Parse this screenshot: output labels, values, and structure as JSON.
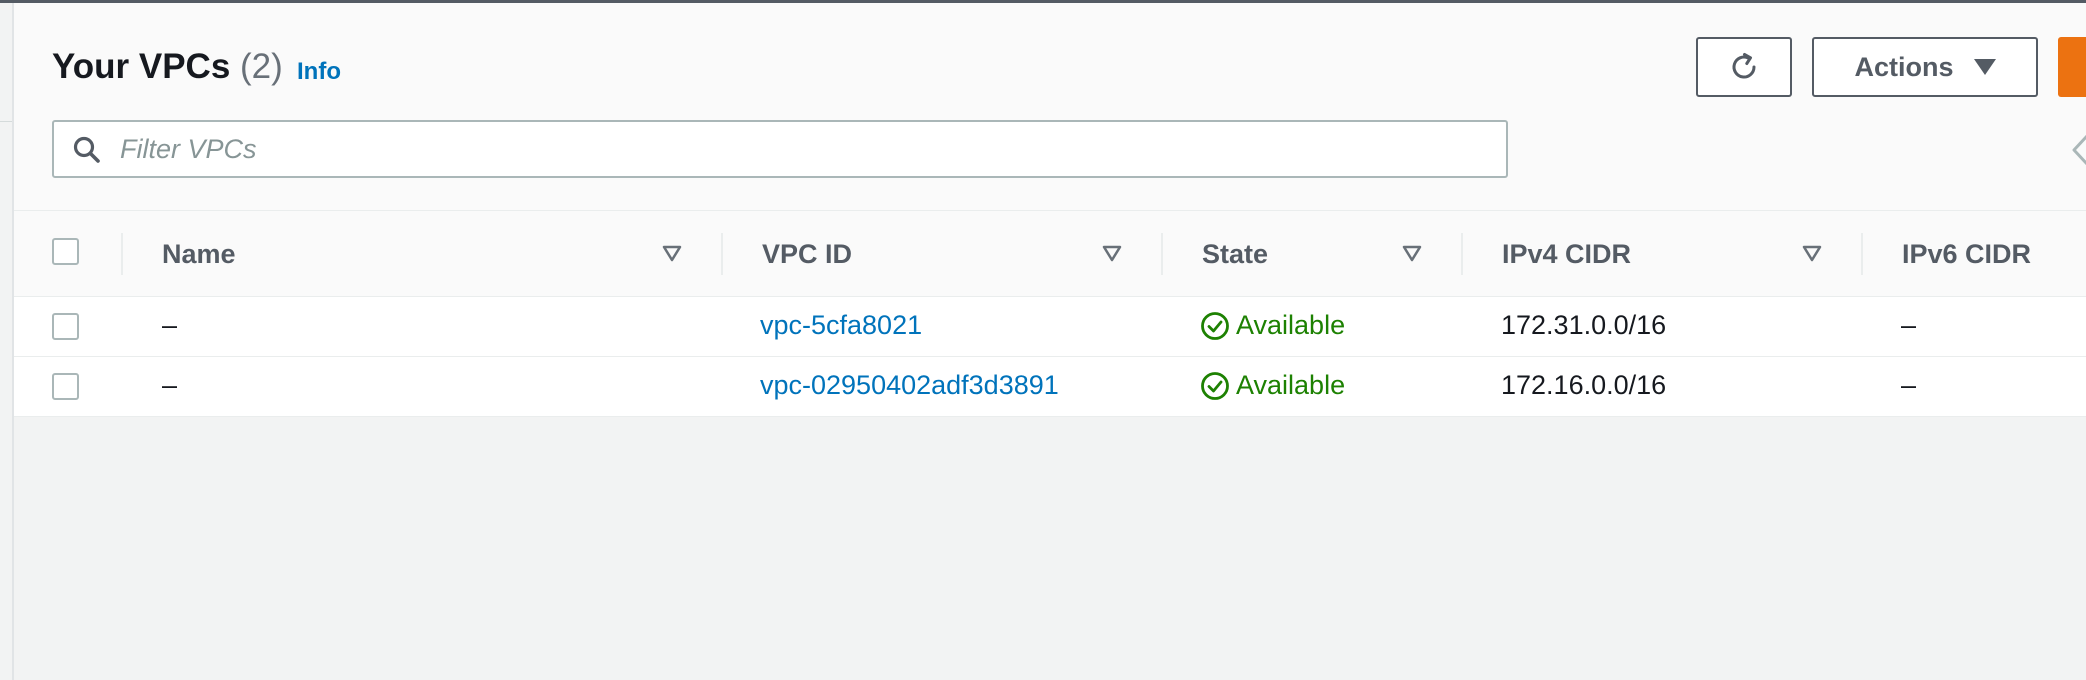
{
  "header": {
    "title": "Your VPCs",
    "count": "(2)",
    "info_label": "Info"
  },
  "toolbar": {
    "refresh_icon": "refresh-icon",
    "actions_label": "Actions",
    "actions_icon": "caret-down-icon"
  },
  "search": {
    "placeholder": "Filter VPCs",
    "value": "",
    "icon": "search-icon"
  },
  "pagination": {
    "prev_icon": "chevron-left-icon"
  },
  "table": {
    "columns": [
      {
        "label": "Name"
      },
      {
        "label": "VPC ID"
      },
      {
        "label": "State"
      },
      {
        "label": "IPv4 CIDR"
      },
      {
        "label": "IPv6 CIDR"
      }
    ],
    "rows": [
      {
        "name": "–",
        "vpc_id": "vpc-5cfa8021",
        "state": "Available",
        "ipv4": "172.31.0.0/16",
        "ipv6": "–"
      },
      {
        "name": "–",
        "vpc_id": "vpc-02950402adf3d3891",
        "state": "Available",
        "ipv4": "172.16.0.0/16",
        "ipv6": "–"
      }
    ]
  },
  "colors": {
    "link": "#0073bb",
    "success": "#1d8102",
    "primary_button": "#ec7211",
    "border": "#545b64"
  }
}
